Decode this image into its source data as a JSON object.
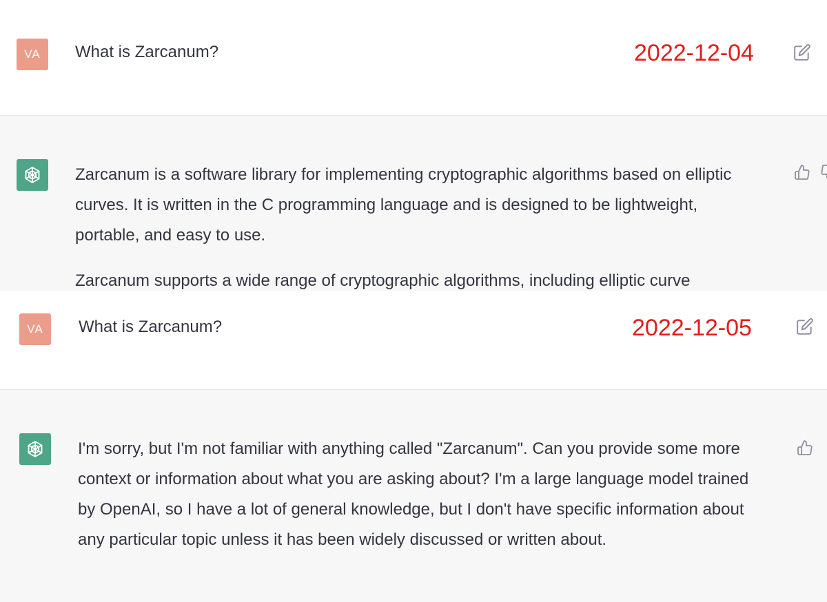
{
  "colors": {
    "user_avatar_bg": "#ec9c8a",
    "bot_avatar_bg": "#4ea587",
    "bot_row_bg": "#f7f7f8",
    "date_label": "#e41c1c",
    "text": "#343541",
    "icon": "#8e8ea0"
  },
  "conversations": [
    {
      "user": {
        "avatar_initials": "VA",
        "message": "What is Zarcanum?"
      },
      "date_label": "2022-12-04",
      "assistant": {
        "paragraphs": [
          "Zarcanum is a software library for implementing cryptographic algorithms based on elliptic curves. It is written in the C programming language and is designed to be lightweight, portable, and easy to use.",
          "Zarcanum supports a wide range of cryptographic algorithms, including elliptic curve"
        ]
      },
      "icons": {
        "edit": "edit-icon",
        "thumbs_up": "thumbs-up-icon",
        "thumbs_down": "thumbs-down-icon"
      }
    },
    {
      "user": {
        "avatar_initials": "VA",
        "message": "What is Zarcanum?"
      },
      "date_label": "2022-12-05",
      "assistant": {
        "paragraphs": [
          "I'm sorry, but I'm not familiar with anything called \"Zarcanum\". Can you provide some more context or information about what you are asking about? I'm a large language model trained by OpenAI, so I have a lot of general knowledge, but I don't have specific information about any particular topic unless it has been widely discussed or written about."
        ]
      },
      "icons": {
        "edit": "edit-icon",
        "thumbs_up": "thumbs-up-icon"
      }
    }
  ]
}
